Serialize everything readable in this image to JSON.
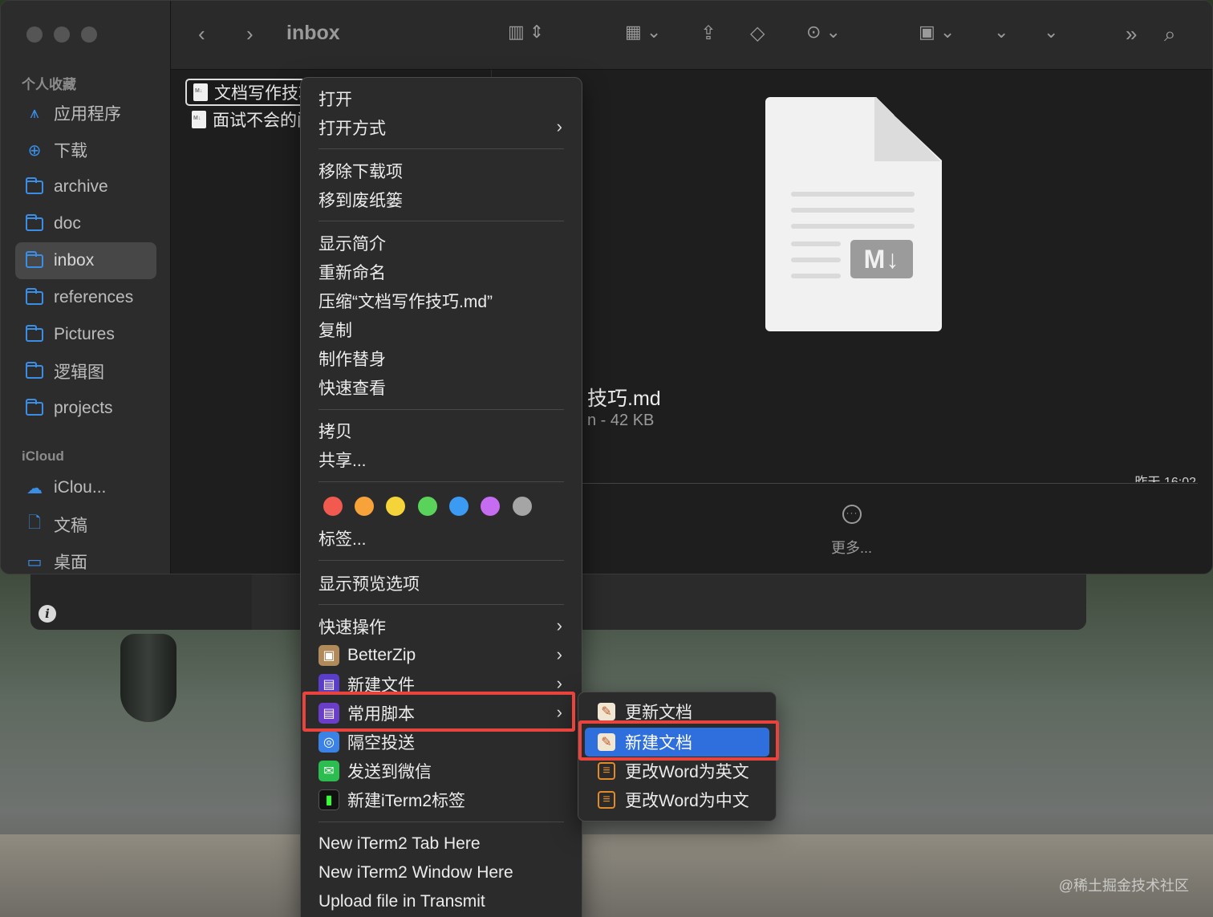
{
  "window": {
    "title": "inbox"
  },
  "sidebar": {
    "favorites_header": "个人收藏",
    "favorites": [
      {
        "label": "应用程序",
        "icon": "applications-icon"
      },
      {
        "label": "下载",
        "icon": "download-icon"
      },
      {
        "label": "archive",
        "icon": "folder-icon"
      },
      {
        "label": "doc",
        "icon": "folder-icon"
      },
      {
        "label": "inbox",
        "icon": "folder-icon",
        "selected": true
      },
      {
        "label": "references",
        "icon": "folder-icon"
      },
      {
        "label": "Pictures",
        "icon": "folder-icon"
      },
      {
        "label": "逻辑图",
        "icon": "folder-icon"
      },
      {
        "label": "projects",
        "icon": "folder-icon"
      }
    ],
    "icloud_header": "iCloud",
    "icloud": [
      {
        "label": "iClou...",
        "icon": "cloud-icon"
      },
      {
        "label": "文稿",
        "icon": "document-icon"
      },
      {
        "label": "桌面",
        "icon": "desktop-icon"
      }
    ]
  },
  "files": [
    {
      "name": "文档写作技巧.md",
      "selected": true
    },
    {
      "name": "面试不会的问题.md",
      "selected": false
    }
  ],
  "preview": {
    "filename_visible": "技巧.md",
    "meta_visible": "n - 42 KB",
    "date_visible": "昨天 16:02",
    "more_label": "更多..."
  },
  "context_menu": {
    "items": {
      "open": "打开",
      "open_with": "打开方式",
      "remove_download": "移除下载项",
      "move_to_trash": "移到废纸篓",
      "get_info": "显示简介",
      "rename": "重新命名",
      "compress": "压缩“文档写作技巧.md”",
      "duplicate": "复制",
      "make_alias": "制作替身",
      "quick_look": "快速查看",
      "copy": "拷贝",
      "share": "共享...",
      "tags": "标签...",
      "show_preview_options": "显示预览选项",
      "quick_actions": "快速操作",
      "betterzip": "BetterZip",
      "new_file": "新建文件",
      "common_scripts": "常用脚本",
      "airdrop": "隔空投送",
      "send_wechat": "发送到微信",
      "new_iterm2_tag": "新建iTerm2标签",
      "new_iterm2_tab": "New iTerm2 Tab Here",
      "new_iterm2_window": "New iTerm2 Window Here",
      "upload_transmit": "Upload file in Transmit"
    },
    "tag_colors": [
      "#f25a50",
      "#f7a339",
      "#f5d43a",
      "#5ad35a",
      "#3b9af2",
      "#c66cf0",
      "#a5a5a5"
    ]
  },
  "submenu": {
    "items": [
      {
        "label": "更新文档",
        "active": false
      },
      {
        "label": "新建文档",
        "active": true
      },
      {
        "label": "更改Word为英文",
        "active": false
      },
      {
        "label": "更改Word为中文",
        "active": false
      }
    ]
  },
  "highlight_color": "#e8433d",
  "accent_color": "#2f6fdd",
  "watermark": "@稀土掘金技术社区"
}
